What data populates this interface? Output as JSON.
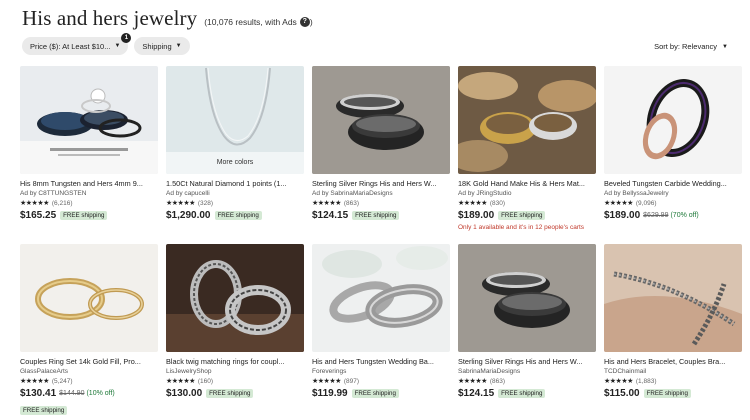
{
  "header": {
    "title": "His and hers jewelry",
    "results": "(10,076 results, with Ads",
    "help_glyph": "?",
    "results_close": ")"
  },
  "filters": {
    "price_label": "Price ($): At Least $10...",
    "price_count": "1",
    "shipping_label": "Shipping"
  },
  "sort": {
    "label": "Sort by: Relevancy"
  },
  "products": [
    {
      "title": "His 8mm Tungsten and Hers 4mm 9...",
      "seller": "Ad by C8TTUNGSTEN",
      "stars": "★★★★★",
      "reviews": "(6,216)",
      "price": "$165.25",
      "free": "FREE shipping"
    },
    {
      "title": "1.50Ct Natural Diamond 1 points (1...",
      "seller": "Ad by capucelli",
      "stars": "★★★★★",
      "reviews": "(328)",
      "price": "$1,290.00",
      "free": "FREE shipping",
      "overlay": "More colors"
    },
    {
      "title": "Sterling Silver Rings His and Hers W...",
      "seller": "Ad by SabrinaMariaDesigns",
      "stars": "★★★★★",
      "reviews": "(863)",
      "price": "$124.15",
      "free": "FREE shipping"
    },
    {
      "title": "18K Gold Hand Make His & Hers Mat...",
      "seller": "Ad by JRingStudio",
      "stars": "★★★★★",
      "reviews": "(830)",
      "price": "$189.00",
      "free": "FREE shipping",
      "notice": "Only 1 available and it's in 12 people's carts"
    },
    {
      "title": "Beveled Tungsten Carbide Wedding...",
      "seller": "Ad by BellyssaJewelry",
      "stars": "★★★★★",
      "reviews": "(9,096)",
      "price": "$189.00",
      "orig": "$629.99",
      "off": "(70% off)"
    },
    {
      "title": "Couples Ring Set 14k Gold Fill, Pro...",
      "seller": "GlassPalaceArts",
      "stars": "★★★★★",
      "reviews": "(5,247)",
      "price": "$130.41",
      "orig": "$144.90",
      "off": "(10% off)",
      "free": "FREE shipping"
    },
    {
      "title": "Black twig matching rings for coupl...",
      "seller": "LisJewelryShop",
      "stars": "★★★★★",
      "reviews": "(160)",
      "price": "$130.00",
      "free": "FREE shipping"
    },
    {
      "title": "His and Hers Tungsten Wedding Ba...",
      "seller": "Foreverings",
      "stars": "★★★★★",
      "reviews": "(897)",
      "price": "$119.99",
      "free": "FREE shipping"
    },
    {
      "title": "Sterling Silver Rings His and Hers W...",
      "seller": "SabrinaMariaDesigns",
      "stars": "★★★★★",
      "reviews": "(863)",
      "price": "$124.15",
      "free": "FREE shipping"
    },
    {
      "title": "His and Hers Bracelet, Couples Bra...",
      "seller": "TCDChainmail",
      "stars": "★★★★★",
      "reviews": "(1,883)",
      "price": "$115.00",
      "free": "FREE shipping"
    }
  ]
}
